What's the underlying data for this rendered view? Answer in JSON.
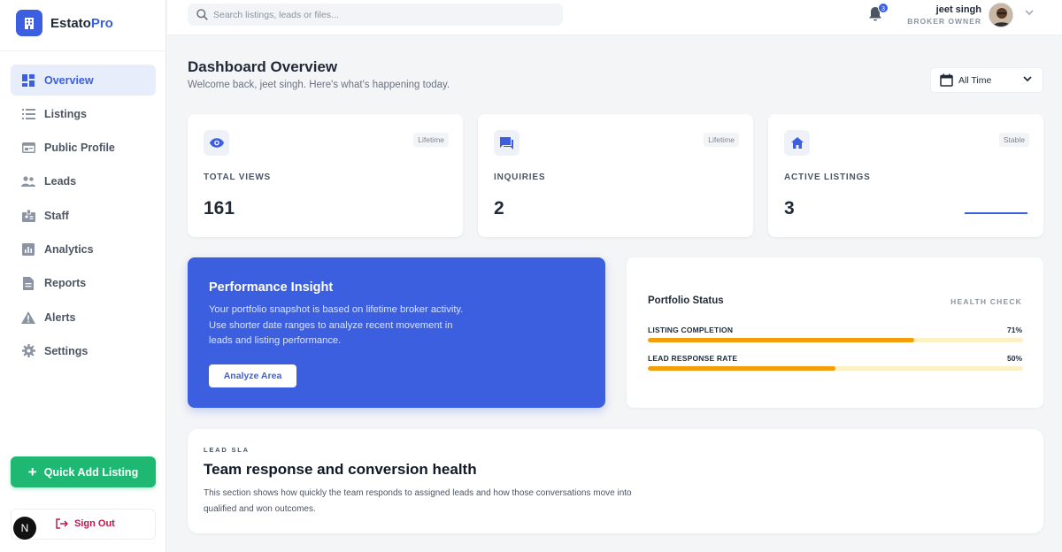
{
  "brand": {
    "name_main": "Estato",
    "name_accent": "Pro"
  },
  "sidebar": {
    "items": [
      {
        "label": "Overview",
        "icon": "dashboard-icon",
        "active": true
      },
      {
        "label": "Listings",
        "icon": "list-icon"
      },
      {
        "label": "Public Profile",
        "icon": "profile-card-icon"
      },
      {
        "label": "Leads",
        "icon": "people-icon"
      },
      {
        "label": "Staff",
        "icon": "badge-icon"
      },
      {
        "label": "Analytics",
        "icon": "bar-chart-icon"
      },
      {
        "label": "Reports",
        "icon": "document-icon"
      },
      {
        "label": "Alerts",
        "icon": "warning-icon"
      },
      {
        "label": "Settings",
        "icon": "gear-icon"
      }
    ],
    "quick_add_label": "Quick Add Listing",
    "avatar_letter": "N",
    "sign_out_label": "Sign Out"
  },
  "topbar": {
    "search_placeholder": "Search listings, leads or files...",
    "notification_count": "3",
    "user_name": "jeet singh",
    "user_role": "BROKER OWNER"
  },
  "header": {
    "title": "Dashboard Overview",
    "subtitle": "Welcome back, jeet singh. Here's what's happening today.",
    "range_label": "All Time"
  },
  "stats": [
    {
      "label": "TOTAL VIEWS",
      "value": "161",
      "tag": "Lifetime",
      "icon": "eye-icon"
    },
    {
      "label": "INQUIRIES",
      "value": "2",
      "tag": "Lifetime",
      "icon": "chat-icon"
    },
    {
      "label": "ACTIVE LISTINGS",
      "value": "3",
      "tag": "Stable",
      "icon": "home-icon"
    }
  ],
  "insight": {
    "title": "Performance Insight",
    "text": "Your portfolio snapshot is based on lifetime broker activity. Use shorter date ranges to analyze recent movement in leads and listing performance.",
    "button_label": "Analyze Area"
  },
  "portfolio": {
    "title": "Portfolio Status",
    "health_label": "HEALTH CHECK",
    "rows": [
      {
        "label": "LISTING COMPLETION",
        "value_text": "71%",
        "percent": 71
      },
      {
        "label": "LEAD RESPONSE RATE",
        "value_text": "50%",
        "percent": 50
      }
    ]
  },
  "sla": {
    "kicker": "LEAD SLA",
    "title": "Team response and conversion health",
    "text": "This section shows how quickly the team responds to assigned leads and how those conversations move into qualified and won outcomes."
  },
  "colors": {
    "accent": "#3b5fe0",
    "success": "#1fb873",
    "warning": "#f59e0b",
    "danger": "#c2194a"
  }
}
